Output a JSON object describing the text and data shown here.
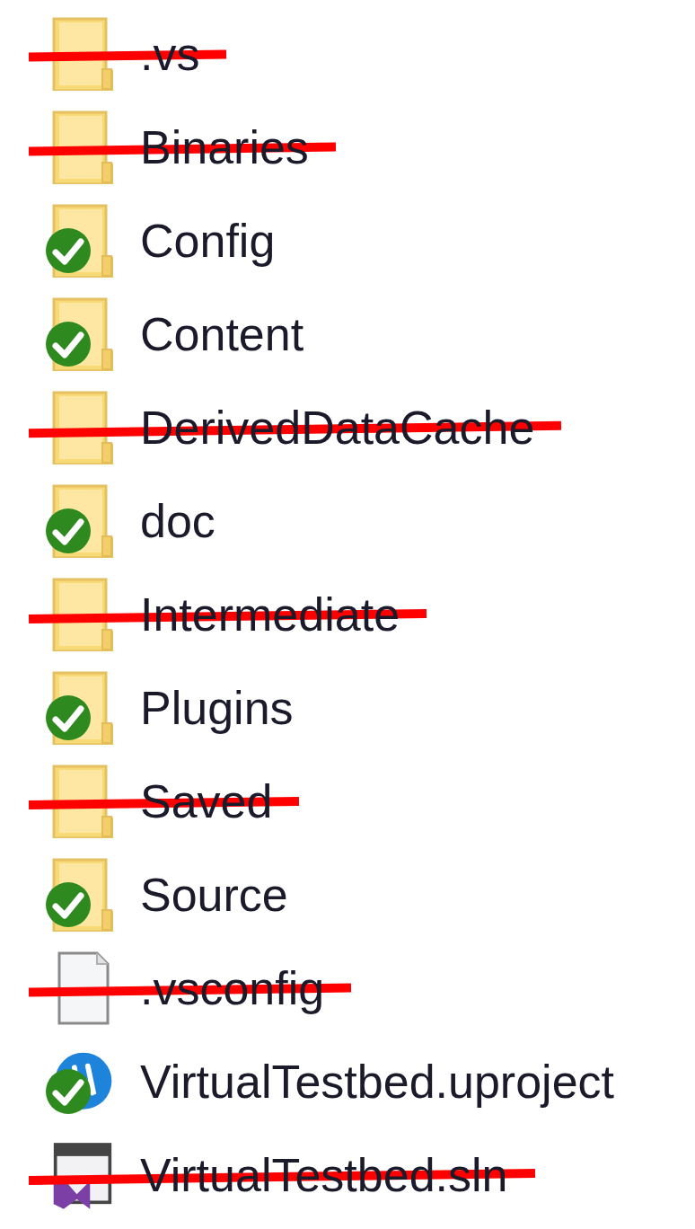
{
  "items": [
    {
      "name": ".vs",
      "kind": "folder",
      "synced": false,
      "struck": true
    },
    {
      "name": "Binaries",
      "kind": "folder",
      "synced": false,
      "struck": true
    },
    {
      "name": "Config",
      "kind": "folder",
      "synced": true,
      "struck": false
    },
    {
      "name": "Content",
      "kind": "folder",
      "synced": true,
      "struck": false
    },
    {
      "name": "DerivedDataCache",
      "kind": "folder",
      "synced": false,
      "struck": true
    },
    {
      "name": "doc",
      "kind": "folder",
      "synced": true,
      "struck": false
    },
    {
      "name": "Intermediate",
      "kind": "folder",
      "synced": false,
      "struck": true
    },
    {
      "name": "Plugins",
      "kind": "folder",
      "synced": true,
      "struck": false
    },
    {
      "name": "Saved",
      "kind": "folder",
      "synced": false,
      "struck": true
    },
    {
      "name": "Source",
      "kind": "folder",
      "synced": true,
      "struck": false
    },
    {
      "name": ".vsconfig",
      "kind": "file",
      "synced": false,
      "struck": true
    },
    {
      "name": "VirtualTestbed.uproject",
      "kind": "project",
      "synced": true,
      "struck": false
    },
    {
      "name": "VirtualTestbed.sln",
      "kind": "solution",
      "synced": false,
      "struck": true
    }
  ]
}
